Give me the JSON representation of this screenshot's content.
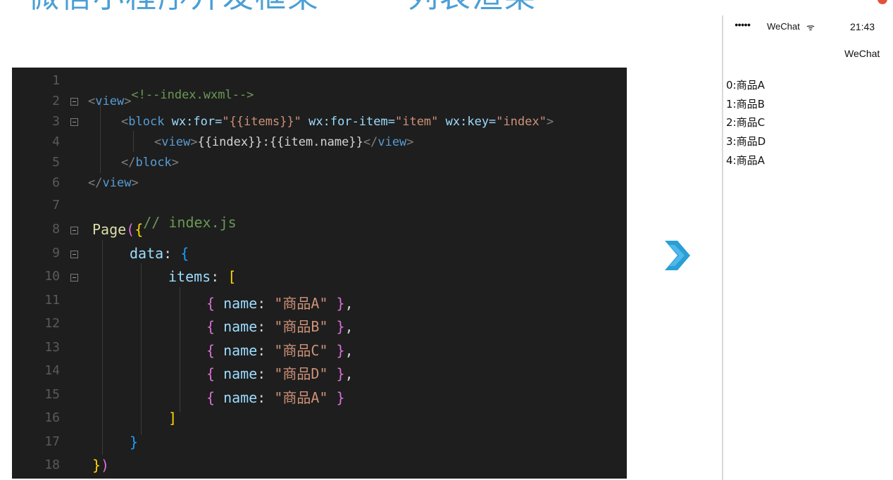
{
  "slide": {
    "title": "微信小程序开发框架 —— 列表渲染"
  },
  "editor": {
    "lines": [
      {
        "num": "1"
      },
      {
        "num": "2"
      },
      {
        "num": "3"
      },
      {
        "num": "4"
      },
      {
        "num": "5"
      },
      {
        "num": "6"
      },
      {
        "num": "7"
      },
      {
        "num": "8"
      },
      {
        "num": "9"
      },
      {
        "num": "10"
      },
      {
        "num": "11"
      },
      {
        "num": "12"
      },
      {
        "num": "13"
      },
      {
        "num": "14"
      },
      {
        "num": "15"
      },
      {
        "num": "16"
      },
      {
        "num": "17"
      },
      {
        "num": "18"
      }
    ],
    "tokens": {
      "l1_comment": "<!--index.wxml-->",
      "l2_open": "<",
      "l2_tag": "view",
      "l2_close": ">",
      "l3_open": "<",
      "l3_tag": "block",
      "l3_attr1": " wx:for=",
      "l3_val1": "\"{{items}}\"",
      "l3_attr2": " wx:for-item=",
      "l3_val2": "\"item\"",
      "l3_attr3": " wx:key=",
      "l3_val3": "\"index\"",
      "l3_close": ">",
      "l4_open": "<",
      "l4_tag": "view",
      "l4_gt": ">",
      "l4_text": "{{index}}:{{item.name}}",
      "l4_end_open": "</",
      "l4_end_tag": "view",
      "l4_end_close": ">",
      "l5_open": "</",
      "l5_tag": "block",
      "l5_close": ">",
      "l6_open": "</",
      "l6_tag": "view",
      "l6_close": ">",
      "l7_comment": "// index.js",
      "l8_fn": "Page",
      "l8_paren": "(",
      "l8_brace": "{",
      "l9_key": "data",
      "l9_colon": ": ",
      "l9_brace": "{",
      "l10_key": "items",
      "l10_colon": ": ",
      "l10_bracket": "[",
      "item_open": "{ ",
      "item_key": "name",
      "item_colon": ": ",
      "item_close": " }",
      "item_comma": ",",
      "l11_val": "\"商品A\"",
      "l12_val": "\"商品B\"",
      "l13_val": "\"商品C\"",
      "l14_val": "\"商品D\"",
      "l15_val": "\"商品A\"",
      "l16_bracket": "]",
      "l17_brace": "}",
      "l18_brace": "}",
      "l18_paren": ")"
    }
  },
  "arrow": {
    "icon": "chevron-right-icon",
    "color": "#2a9fd6"
  },
  "phone": {
    "status": {
      "signal": "●●●●●",
      "carrier": "WeChat",
      "wifi": "ᯤ",
      "time": "21:43"
    },
    "nav_title": "WeChat",
    "list": [
      "0:商品A",
      "1:商品B",
      "2:商品C",
      "3:商品D",
      "4:商品A"
    ]
  }
}
